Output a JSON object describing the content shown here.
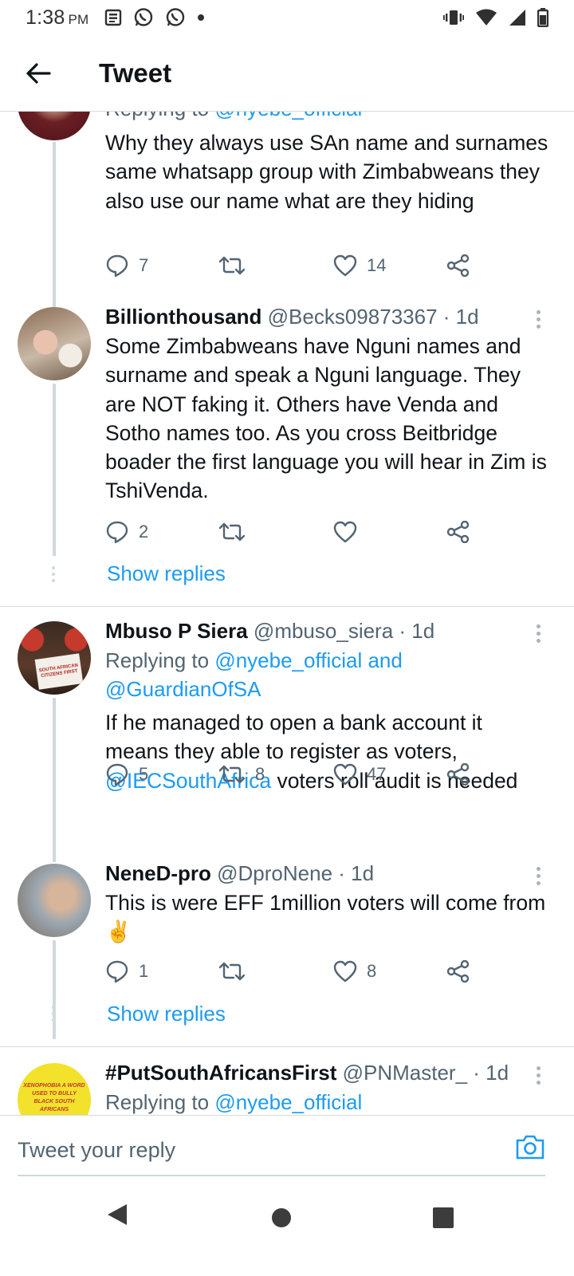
{
  "status_bar": {
    "time": "1:38",
    "ampm": "PM"
  },
  "app_bar": {
    "title": "Tweet"
  },
  "tweets": [
    {
      "replying_prefix": "Replying to ",
      "replying_to": "@nyebe_official",
      "body": "Why they always use SAn name and surnames same whatsapp group with Zimbabweans they also use our name what are they hiding",
      "replies": "7",
      "retweets": "",
      "likes": "14"
    },
    {
      "name": "Billionthousand",
      "handle": "@Becks09873367",
      "time": "· 1d",
      "body": "Some Zimbabweans have Nguni names and surname and speak a Nguni language. They are NOT faking it. Others have Venda and Sotho names too. As you cross Beitbridge boader the first language you will hear in Zim is TshiVenda.",
      "replies": "2",
      "retweets": "",
      "likes": "",
      "show_replies": "Show replies"
    },
    {
      "name": "Mbuso P Siera",
      "handle": "@mbuso_siera",
      "time": "· 1d",
      "replying_prefix": "Replying to ",
      "replying_to": "@nyebe_official and @GuardianOfSA",
      "body_mention": "@IECSouthAfrica",
      "body_pre": "If he managed to open a bank account it means they able to register as voters, ",
      "body_post": " voters roll audit  is needed",
      "replies": "5",
      "retweets": "8",
      "likes": "47",
      "avatar_sign": "SOUTH AFRICAN CITIZENS FIRST"
    },
    {
      "name": "NeneD-pro",
      "handle": "@DproNene",
      "time": "· 1d",
      "body": "This is were EFF 1million voters will come from ✌️",
      "replies": "1",
      "retweets": "",
      "likes": "8",
      "show_replies": "Show replies"
    },
    {
      "name": "#PutSouthAfricansFirst",
      "handle": "@PNMaster_",
      "time": "· 1d",
      "replying_prefix": "Replying to ",
      "replying_to": "@nyebe_official",
      "avatar_text": "XENOPHOBIA A WORD USED TO BULLY BLACK SOUTH AFRICANS"
    }
  ],
  "composer": {
    "placeholder": "Tweet your reply"
  },
  "icons": {
    "back": "arrow-left-icon",
    "reply": "comment-icon",
    "retweet": "retweet-icon",
    "like": "heart-icon",
    "share": "share-icon",
    "camera": "camera-icon",
    "more": "more-vertical-icon"
  },
  "colors": {
    "link": "#1d9bf0",
    "text": "#0f1419",
    "secondary": "#536471"
  }
}
